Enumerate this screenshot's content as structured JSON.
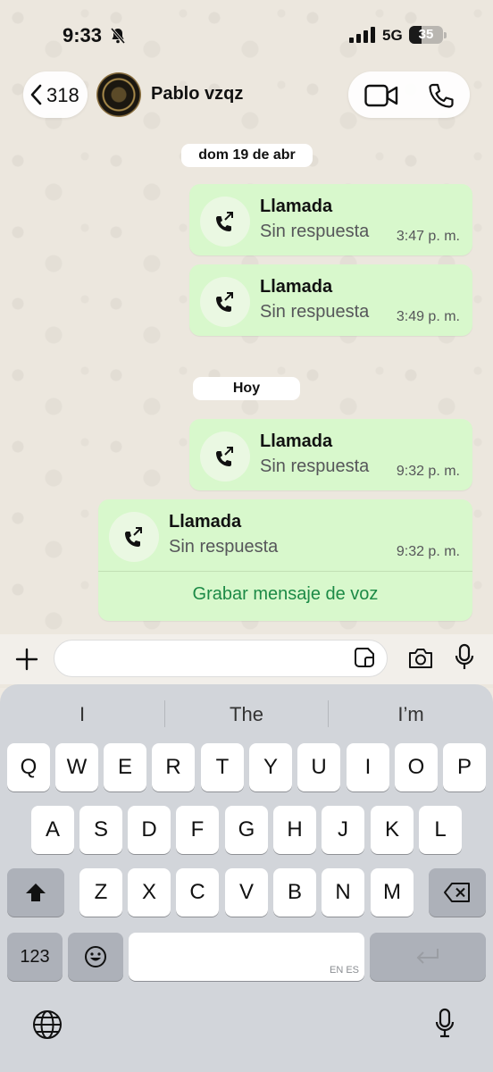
{
  "status_bar": {
    "time": "9:33",
    "network": "5G",
    "battery": "35"
  },
  "header": {
    "back_count": "318",
    "contact_name": "Pablo vzqz"
  },
  "chat": {
    "dates": [
      "dom 19 de abr",
      "Hoy"
    ],
    "calls": [
      {
        "title": "Llamada",
        "status": "Sin respuesta",
        "time": "3:47 p. m."
      },
      {
        "title": "Llamada",
        "status": "Sin respuesta",
        "time": "3:49 p. m."
      },
      {
        "title": "Llamada",
        "status": "Sin respuesta",
        "time": "9:32 p. m."
      },
      {
        "title": "Llamada",
        "status": "Sin respuesta",
        "time": "9:32 p. m.",
        "action": "Grabar mensaje de voz"
      }
    ]
  },
  "input": {
    "placeholder": ""
  },
  "keyboard": {
    "suggestions": [
      "I",
      "The",
      "I’m"
    ],
    "row1": [
      "Q",
      "W",
      "E",
      "R",
      "T",
      "Y",
      "U",
      "I",
      "O",
      "P"
    ],
    "row2": [
      "A",
      "S",
      "D",
      "F",
      "G",
      "H",
      "J",
      "K",
      "L"
    ],
    "row3": [
      "Z",
      "X",
      "C",
      "V",
      "B",
      "N",
      "M"
    ],
    "numbers_key": "123",
    "space_lang": "EN ES"
  },
  "colors": {
    "bubble": "#d8f8cc",
    "accent": "#1c8a46",
    "keyboard": "#d2d5da"
  }
}
